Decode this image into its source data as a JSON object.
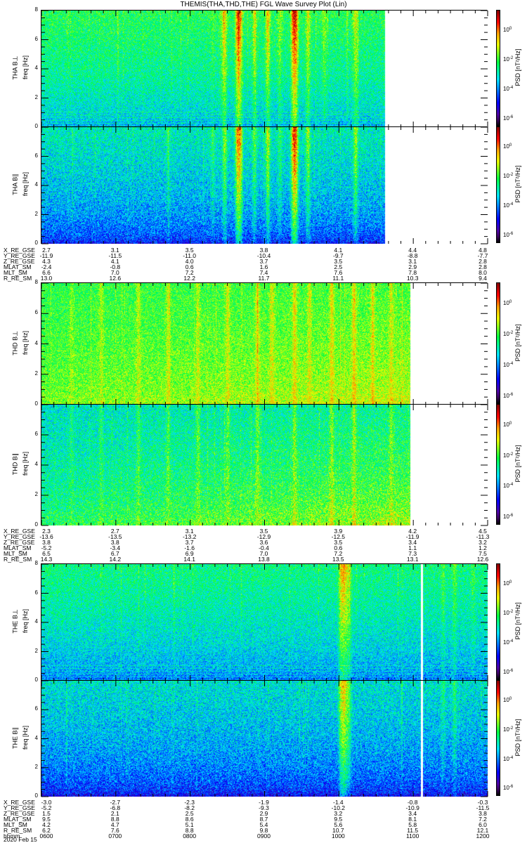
{
  "title": "THEMIS(THA,THD,THE) FGL Wave Survey Plot (Lin)",
  "chart_data": {
    "type": "heatmap",
    "x_axis": {
      "label": "hhmm",
      "range_hours": [
        6,
        12
      ],
      "tick_labels": [
        "0600",
        "0700",
        "0800",
        "0900",
        "1000",
        "1100",
        "1200"
      ],
      "date": "2020 Feb 15"
    },
    "colorbar": {
      "label": "PSD [nT²/Hz]",
      "log10_range": [
        -6.6,
        1.3
      ],
      "ticks": [
        {
          "exp": "0",
          "log10": 0
        },
        {
          "exp": "-2",
          "log10": -2
        },
        {
          "exp": "-4",
          "log10": -4
        },
        {
          "exp": "-6",
          "log10": -6
        }
      ]
    },
    "colormap": [
      "#000000",
      "#5a0090",
      "#0000ff",
      "#00e0ff",
      "#00ff40",
      "#e8ff00",
      "#ffa000",
      "#ff0000",
      "#800000"
    ],
    "panels": [
      {
        "probe": "THA",
        "ylabel": "THA B⊥",
        "flabel": "freq [Hz]",
        "yticks": [
          "0",
          "2",
          "4",
          "6",
          "8"
        ],
        "ylim": [
          0,
          8
        ],
        "data_end_hour": 10.62,
        "psd_high": -2.3,
        "psd_low": -4.3,
        "noise": 0.9,
        "lines": true,
        "bursts": [
          [
            8.3,
            0.4
          ],
          [
            8.42,
            0.6
          ],
          [
            8.46,
            1.6
          ],
          [
            8.63,
            2.2
          ],
          [
            8.67,
            2.0
          ],
          [
            8.86,
            1.2
          ],
          [
            9.04,
            1.8
          ],
          [
            9.2,
            0.8
          ],
          [
            9.38,
            2.4
          ],
          [
            9.42,
            2.4
          ],
          [
            9.58,
            1.4
          ],
          [
            9.8,
            0.8
          ],
          [
            10.22,
            1.4
          ]
        ],
        "gaps": []
      },
      {
        "probe": "THA",
        "ylabel": "THA B∥",
        "flabel": "freq [Hz]",
        "yticks": [
          "0",
          "2",
          "4",
          "6"
        ],
        "ylim": [
          0,
          8
        ],
        "data_end_hour": 10.62,
        "psd_high": -3.0,
        "psd_low": -5.4,
        "noise": 1.0,
        "lines": false,
        "bursts": [
          [
            7.7,
            0.6
          ],
          [
            8.3,
            0.8
          ],
          [
            8.46,
            1.6
          ],
          [
            8.63,
            2.6
          ],
          [
            8.67,
            2.4
          ],
          [
            8.86,
            1.2
          ],
          [
            9.04,
            2.0
          ],
          [
            9.2,
            0.8
          ],
          [
            9.38,
            2.8
          ],
          [
            9.42,
            2.8
          ],
          [
            9.58,
            1.6
          ],
          [
            10.22,
            1.8
          ]
        ],
        "gaps": []
      },
      {
        "probe": "THD",
        "ylabel": "THD B⊥",
        "flabel": "freq [Hz]",
        "yticks": [
          "0",
          "2",
          "4",
          "6",
          "8"
        ],
        "ylim": [
          0,
          8
        ],
        "data_end_hour": 10.96,
        "psd_high": -2.2,
        "psd_low": -1.4,
        "noise": 0.8,
        "lines": false,
        "ramp": 0.6,
        "bursts": [
          [
            6.4,
            0.6
          ],
          [
            6.8,
            0.8
          ],
          [
            7.3,
            0.9
          ],
          [
            7.7,
            1.0
          ],
          [
            8.1,
            0.9
          ],
          [
            8.5,
            1.0
          ],
          [
            8.9,
            1.1
          ],
          [
            9.1,
            1.0
          ],
          [
            9.4,
            1.3
          ],
          [
            9.6,
            1.0
          ],
          [
            9.9,
            1.2
          ],
          [
            10.2,
            1.3
          ],
          [
            10.45,
            1.0
          ],
          [
            10.7,
            0.9
          ]
        ],
        "gaps": []
      },
      {
        "probe": "THD",
        "ylabel": "THD B∥",
        "flabel": "freq [Hz]",
        "yticks": [
          "0",
          "2",
          "4",
          "6"
        ],
        "ylim": [
          0,
          8
        ],
        "data_end_hour": 10.96,
        "psd_high": -3.2,
        "psd_low": -2.0,
        "noise": 1.0,
        "lines": false,
        "ramp": 1.2,
        "bursts": [
          [
            6.4,
            0.5
          ],
          [
            6.8,
            0.7
          ],
          [
            7.3,
            0.8
          ],
          [
            7.7,
            0.9
          ],
          [
            8.1,
            0.9
          ],
          [
            8.5,
            1.0
          ],
          [
            8.9,
            1.1
          ],
          [
            9.4,
            1.2
          ],
          [
            9.9,
            1.2
          ],
          [
            10.2,
            1.3
          ],
          [
            10.7,
            0.9
          ]
        ],
        "gaps": []
      },
      {
        "probe": "THE",
        "ylabel": "THE B⊥",
        "flabel": "freq [Hz]",
        "yticks": [
          "0",
          "2",
          "4",
          "6",
          "8"
        ],
        "ylim": [
          0,
          8
        ],
        "data_end_hour": 12.0,
        "psd_high": -2.6,
        "psd_low": -4.8,
        "noise": 0.9,
        "lines": true,
        "bursts": [
          [
            10.02,
            1.6
          ],
          [
            10.06,
            1.8
          ],
          [
            10.1,
            1.4
          ],
          [
            10.14,
            1.0
          ],
          [
            11.4,
            0.6
          ],
          [
            11.55,
            0.8
          ],
          [
            11.8,
            0.5
          ]
        ],
        "gaps": [
          [
            11.1,
            11.12
          ]
        ]
      },
      {
        "probe": "THE",
        "ylabel": "THE B∥",
        "flabel": "freq [Hz]",
        "yticks": [
          "0",
          "2",
          "4",
          "6"
        ],
        "ylim": [
          0,
          8
        ],
        "data_end_hour": 12.0,
        "psd_high": -3.2,
        "psd_low": -5.6,
        "noise": 1.0,
        "lines": false,
        "bursts": [
          [
            10.02,
            1.8
          ],
          [
            10.06,
            2.2
          ],
          [
            10.1,
            1.6
          ],
          [
            10.14,
            1.0
          ],
          [
            11.4,
            0.7
          ],
          [
            11.55,
            0.9
          ]
        ],
        "gaps": [
          [
            11.1,
            11.12
          ]
        ]
      }
    ]
  },
  "ephemeris": [
    {
      "rows": [
        {
          "label": "X_RE_GSE",
          "values": [
            "2.7",
            "3.1",
            "3.5",
            "3.8",
            "4.1",
            "4.4",
            "4.8"
          ]
        },
        {
          "label": "Y_RE_GSE",
          "values": [
            "-11.9",
            "-11.5",
            "-11.0",
            "-10.4",
            "-9.7",
            "-8.8",
            "-7.7"
          ]
        },
        {
          "label": "Z_RE_GSE",
          "values": [
            "4.3",
            "4.1",
            "4.0",
            "3.7",
            "3.5",
            "3.1",
            "2.8"
          ]
        },
        {
          "label": "MLAT_SM",
          "values": [
            "-2.4",
            "-0.8",
            "0.6",
            "1.6",
            "2.5",
            "2.9",
            "2.8"
          ]
        },
        {
          "label": "MLT_SM",
          "values": [
            "6.6",
            "7.0",
            "7.2",
            "7.4",
            "7.6",
            "7.8",
            "8.0"
          ]
        },
        {
          "label": "R_RE_SM",
          "values": [
            "13.0",
            "12.6",
            "12.2",
            "11.7",
            "11.1",
            "10.3",
            "9.4"
          ]
        }
      ]
    },
    {
      "rows": [
        {
          "label": "X_RE_GSE",
          "values": [
            "2.3",
            "2.7",
            "3.1",
            "3.5",
            "3.9",
            "4.2",
            "4.5"
          ]
        },
        {
          "label": "Y_RE_GSE",
          "values": [
            "-13.6",
            "-13.5",
            "-13.2",
            "-12.9",
            "-12.5",
            "-11.9",
            "-11.3"
          ]
        },
        {
          "label": "Z_RE_GSE",
          "values": [
            "3.8",
            "3.8",
            "3.7",
            "3.6",
            "3.5",
            "3.4",
            "3.2"
          ]
        },
        {
          "label": "MLAT_SM",
          "values": [
            "-5.2",
            "-3.4",
            "-1.6",
            "-0.4",
            "0.6",
            "1.1",
            "1.2"
          ]
        },
        {
          "label": "MLT_SM",
          "values": [
            "6.5",
            "6.7",
            "6.9",
            "7.0",
            "7.2",
            "7.3",
            "7.5"
          ]
        },
        {
          "label": "R_RE_SM",
          "values": [
            "14.3",
            "14.2",
            "14.1",
            "13.8",
            "13.5",
            "13.1",
            "12.6"
          ]
        }
      ]
    },
    {
      "rows": [
        {
          "label": "X_RE_GSE",
          "values": [
            "-3.0",
            "-2.7",
            "-2.3",
            "-1.9",
            "-1.4",
            "-0.8",
            "-0.3"
          ]
        },
        {
          "label": "Y_RE_GSE",
          "values": [
            "-5.2",
            "-6.8",
            "-8.2",
            "-9.3",
            "-10.2",
            "-10.9",
            "-11.5"
          ]
        },
        {
          "label": "Z_RE_GSE",
          "values": [
            "1.5",
            "2.1",
            "2.5",
            "2.9",
            "3.2",
            "3.4",
            "3.8"
          ]
        },
        {
          "label": "MLAT_SM",
          "values": [
            "9.5",
            "8.8",
            "8.6",
            "8.7",
            "9.5",
            "8.1",
            "7.2"
          ]
        },
        {
          "label": "MLT_SM",
          "values": [
            "4.2",
            "4.7",
            "5.1",
            "5.4",
            "5.6",
            "5.8",
            "6.0"
          ]
        },
        {
          "label": "R_RE_SM",
          "values": [
            "6.2",
            "7.6",
            "8.8",
            "9.8",
            "10.7",
            "11.5",
            "12.1"
          ]
        },
        {
          "label": "hhmm",
          "values": [
            "0600",
            "0700",
            "0800",
            "0900",
            "1000",
            "1100",
            "1200"
          ]
        }
      ]
    }
  ],
  "date": "2020 Feb 15"
}
